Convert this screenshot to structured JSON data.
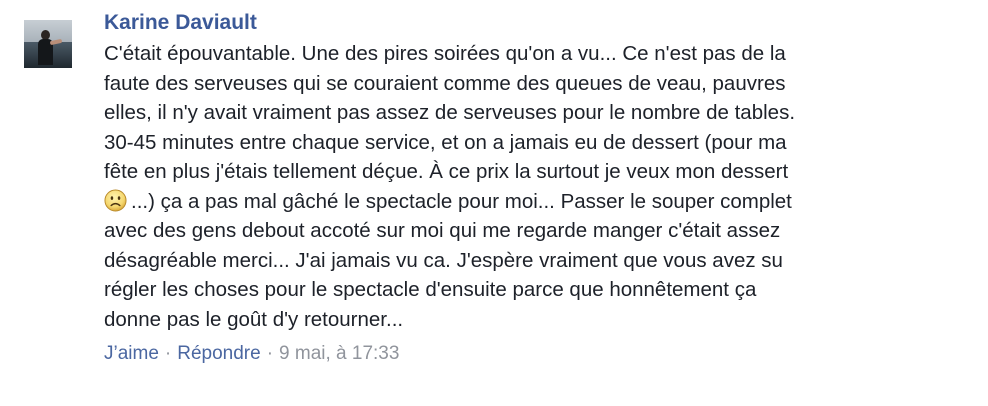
{
  "comment": {
    "author": "Karine Daviault",
    "avatar_icon": "profile-photo-person-at-sea",
    "lines": [
      {
        "text": "C'était épouvantable. Une des pires soirées qu'on a vu... Ce n'est pas de la"
      },
      {
        "text": "faute des serveuses qui se couraient comme des queues de veau, pauvres"
      },
      {
        "text": "elles, il n'y avait vraiment pas assez de serveuses pour le nombre de tables."
      },
      {
        "text": "30-45 minutes entre chaque service, et on a jamais eu de dessert (pour ma"
      },
      {
        "text": "fête en plus j'étais tellement déçue. À ce prix la surtout je veux mon dessert"
      },
      {
        "emoji": "frown-emoji",
        "text": "...) ça a pas mal gâché le spectacle pour moi... Passer le souper complet"
      },
      {
        "text": "avec des gens debout accoté sur moi qui me regarde manger c'était assez"
      },
      {
        "text": "désagréable merci... J'ai jamais vu ca. J'espère vraiment que vous avez su"
      },
      {
        "text": "régler les choses pour le spectacle d'ensuite parce que honnêtement ça"
      },
      {
        "text": "donne pas le goût d'y retourner..."
      }
    ],
    "actions": {
      "like_label": "J’aime",
      "separator": "·",
      "reply_label": "Répondre",
      "timestamp": "9 mai, à 17:33"
    },
    "colors": {
      "link": "#4b67a1",
      "author": "#3b5998",
      "text": "#1d2129",
      "meta": "#90949c"
    }
  }
}
